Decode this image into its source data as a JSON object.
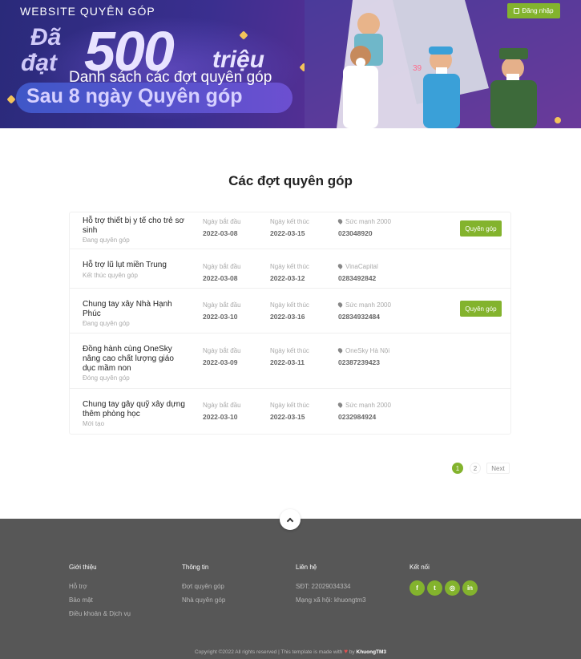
{
  "header": {
    "brand": "WEBSITE QUYÊN GÓP",
    "login_label": "Đăng nhập",
    "hero_title": "Danh sách các đợt quyên góp",
    "banner": {
      "line1": "Đã",
      "line2": "đạt",
      "number": "500",
      "unit": "triệu",
      "tagline": "Sau 8 ngày Quyên góp"
    }
  },
  "main": {
    "title": "Các đợt quyên góp",
    "columns": {
      "start": "Ngày bắt đầu",
      "end": "Ngày kết thúc"
    },
    "donate_label": "Quyên góp",
    "campaigns": [
      {
        "name": "Hỗ trợ thiết bị y tế cho trẻ sơ sinh",
        "status": "Đang quyên góp",
        "start": "2022-03-08",
        "end": "2022-03-15",
        "org": "Sức mạnh 2000",
        "phone": "023048920",
        "donate": true
      },
      {
        "name": "Hỗ trợ lũ lụt miền Trung",
        "status": "Kết thúc quyên góp",
        "start": "2022-03-08",
        "end": "2022-03-12",
        "org": "VinaCapital",
        "phone": "0283492842",
        "donate": false
      },
      {
        "name": "Chung tay xây Nhà Hạnh Phúc",
        "status": "Đang quyên góp",
        "start": "2022-03-10",
        "end": "2022-03-16",
        "org": "Sức mạnh 2000",
        "phone": "02834932484",
        "donate": true
      },
      {
        "name": "Đồng hành cùng OneSky nâng cao chất lượng giáo dục mầm non",
        "status": "Đóng quyên góp",
        "start": "2022-03-09",
        "end": "2022-03-11",
        "org": "OneSky Hà Nội",
        "phone": "02387239423",
        "donate": false
      },
      {
        "name": "Chung tay gây quỹ xây dựng thêm phòng học",
        "status": "Mới tạo",
        "start": "2022-03-10",
        "end": "2022-03-15",
        "org": "Sức mạnh 2000",
        "phone": "0232984924",
        "donate": false
      }
    ]
  },
  "pagination": {
    "pages": [
      "1",
      "2"
    ],
    "current": "1",
    "next_label": "Next"
  },
  "footer": {
    "about": {
      "title": "Giới thiệu",
      "links": [
        "Hỗ trợ",
        "Bảo mật",
        "Điều khoản & Dịch vụ"
      ]
    },
    "info": {
      "title": "Thông tin",
      "links": [
        "Đợt quyên góp",
        "Nhà quyên góp"
      ]
    },
    "contact": {
      "title": "Liên hệ",
      "lines": [
        "SĐT: 22029034334",
        "Mạng xã hội: khuongtm3"
      ]
    },
    "connect": {
      "title": "Kết nối",
      "socials": [
        {
          "icon": "facebook-icon",
          "glyph": "f"
        },
        {
          "icon": "twitter-icon",
          "glyph": "t"
        },
        {
          "icon": "instagram-icon",
          "glyph": "◎"
        },
        {
          "icon": "linkedin-icon",
          "glyph": "in"
        }
      ]
    },
    "copyright": "Copyright ©2022 All rights reserved | This template is made with",
    "by": "by",
    "author": "KhuongTM3"
  },
  "colors": {
    "accent": "#83b32d",
    "footer_bg": "#575757",
    "hero_bg": "#3a2f8f"
  }
}
